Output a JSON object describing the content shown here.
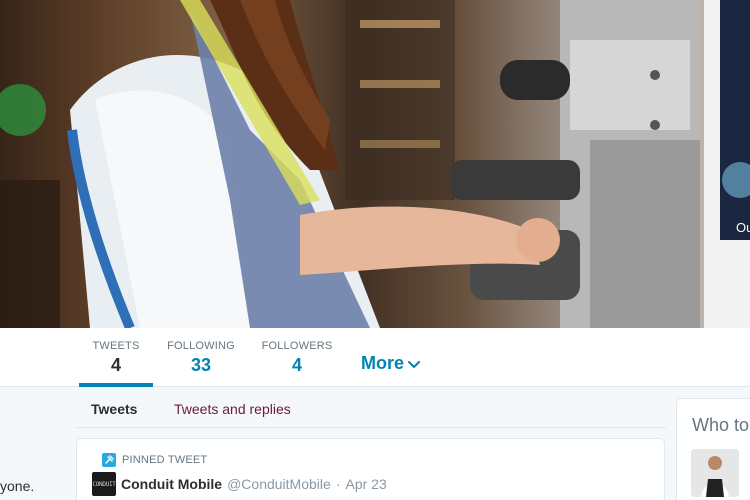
{
  "profile_nav": {
    "stats": [
      {
        "label": "TWEETS",
        "value": "4"
      },
      {
        "label": "FOLLOWING",
        "value": "33"
      },
      {
        "label": "FOLLOWERS",
        "value": "4"
      }
    ],
    "more_label": "More"
  },
  "bio": {
    "fragment": "yone."
  },
  "timeline": {
    "tabs": [
      {
        "label": "Tweets"
      },
      {
        "label": "Tweets and replies"
      }
    ],
    "pinned_tweet": {
      "pinned_label": "PINNED TWEET",
      "avatar_text": "CONDUIT",
      "author_name": "Conduit Mobile",
      "author_handle": "@ConduitMobile",
      "separator": "·",
      "date": "Apr 23"
    }
  },
  "who_to_follow": {
    "title": "Who to follow"
  },
  "header_overlay": {
    "text": "Ou"
  },
  "colors": {
    "accent": "#0084b4",
    "replies_tab": "#6a1b38",
    "pinned_badge": "#2aa9e0"
  },
  "icons": {
    "more": "chevron-down-icon",
    "pinned": "pin-icon"
  }
}
